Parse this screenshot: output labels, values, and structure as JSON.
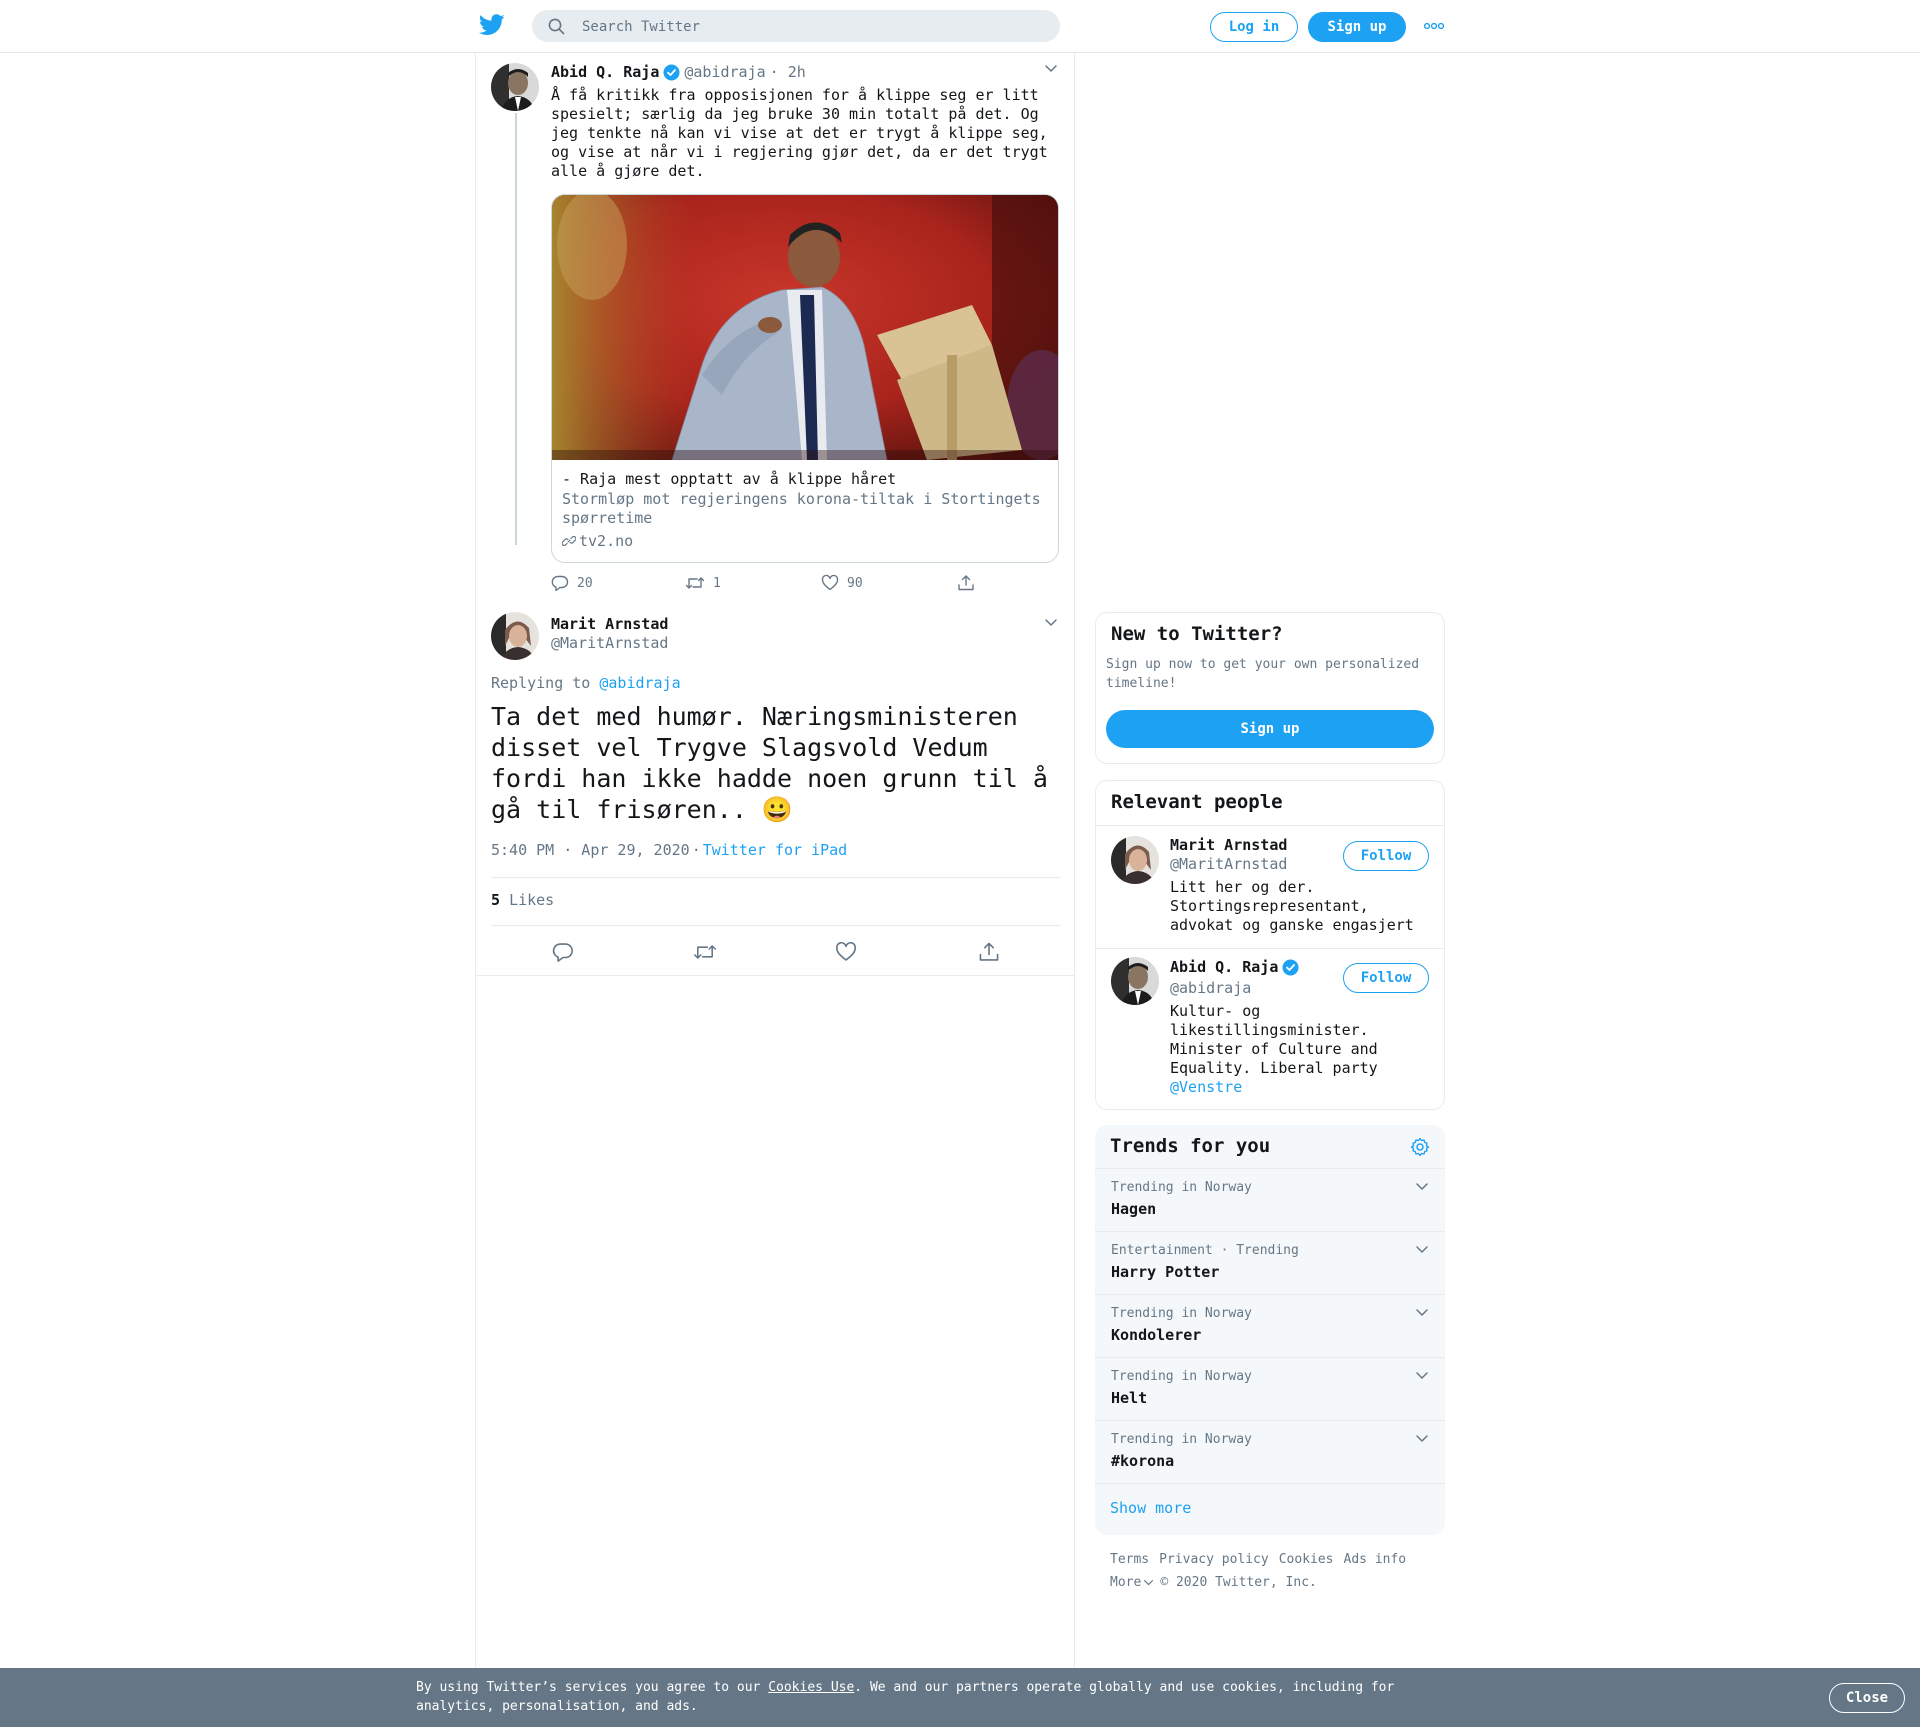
{
  "header": {
    "search_placeholder": "Search Twitter",
    "login_label": "Log in",
    "signup_label": "Sign up"
  },
  "thread_tweet": {
    "name": "Abid Q. Raja",
    "handle": "@abidraja",
    "time": "· 2h",
    "text": "Å få kritikk fra opposisjonen for å klippe seg er litt spesielt; særlig da jeg bruke 30 min totalt på det. Og jeg tenkte nå kan vi vise at det er trygt å klippe seg, og vise at når vi i regjering gjør det, da er det trygt alle å gjøre det.",
    "card": {
      "title": "- Raja mest opptatt av å klippe håret",
      "description": "Stormløp mot regjeringens korona-tiltak i Stortingets spørretime",
      "domain": "tv2.no"
    },
    "replies": "20",
    "retweets": "1",
    "likes": "90"
  },
  "focal_tweet": {
    "name": "Marit Arnstad",
    "handle": "@MaritArnstad",
    "replying_prefix": "Replying to",
    "replying_to": "@abidraja",
    "text": "Ta det med humør. Næringsministeren disset vel Trygve Slagsvold Vedum fordi han ikke hadde noen grunn til å gå til frisøren.. 😀",
    "timestamp": "5:40 PM · Apr 29, 2020",
    "separator": "·",
    "source": "Twitter for iPad",
    "likes_count": "5",
    "likes_label": "Likes"
  },
  "new_to_twitter": {
    "title": "New to Twitter?",
    "text": "Sign up now to get your own personalized timeline!",
    "button": "Sign up"
  },
  "relevant_people": {
    "title": "Relevant people",
    "people": [
      {
        "name": "Marit Arnstad",
        "handle": "@MaritArnstad",
        "bio": "Litt her og der. Stortingsrepresentant, advokat og ganske engasjert",
        "follow": "Follow"
      },
      {
        "name": "Abid Q. Raja",
        "handle": "@abidraja",
        "bio": "Kultur- og likestillingsminister. Minister of Culture and Equality. Liberal party",
        "bio_link": "@Venstre",
        "follow": "Follow"
      }
    ]
  },
  "trends": {
    "title": "Trends for you",
    "items": [
      {
        "context": "Trending in Norway",
        "title": "Hagen"
      },
      {
        "context": "Entertainment · Trending",
        "title": "Harry Potter"
      },
      {
        "context": "Trending in Norway",
        "title": "Kondolerer"
      },
      {
        "context": "Trending in Norway",
        "title": "Helt"
      },
      {
        "context": "Trending in Norway",
        "title": "#korona"
      }
    ],
    "show_more": "Show more"
  },
  "footer": {
    "links": [
      "Terms",
      "Privacy policy",
      "Cookies",
      "Ads info"
    ],
    "more": "More",
    "copyright": "© 2020 Twitter, Inc."
  },
  "cookie_bar": {
    "text_before": "By using Twitter’s services you agree to our ",
    "link": "Cookies Use",
    "text_after": ". We and our partners operate globally and use cookies, including for analytics, personalisation, and ads.",
    "close": "Close"
  },
  "colors": {
    "accent": "#1da1f2",
    "secondary_text": "#657786",
    "cookie_bar": "#657786",
    "trends_bg": "#f5f8fa"
  },
  "icons": [
    "twitter-bird-icon",
    "search-icon",
    "more-dots-icon",
    "chevron-down-icon",
    "verified-badge-icon",
    "link-icon",
    "reply-icon",
    "retweet-icon",
    "like-icon",
    "share-icon",
    "settings-gear-icon"
  ]
}
